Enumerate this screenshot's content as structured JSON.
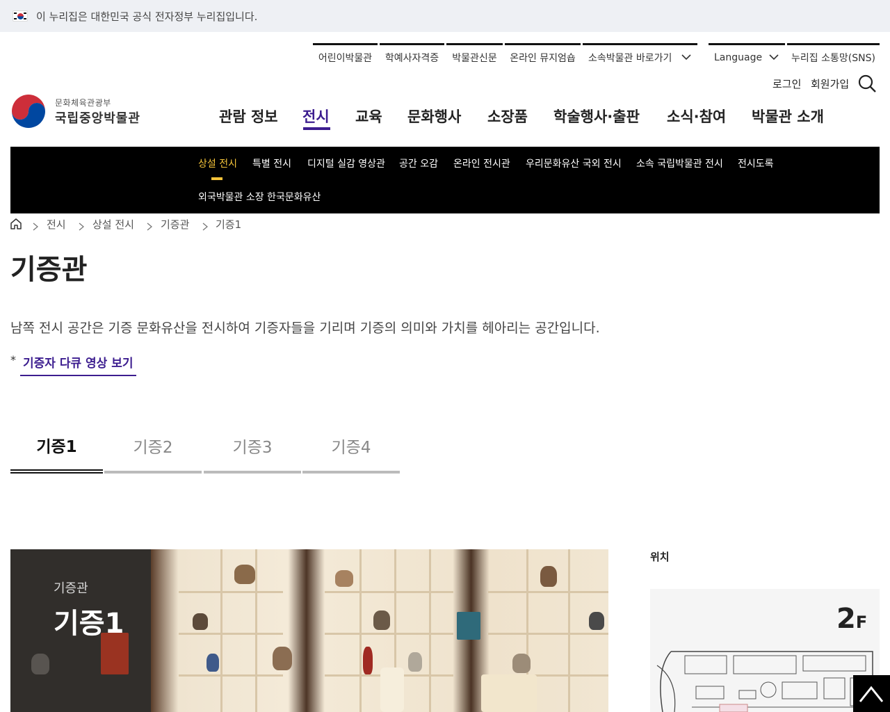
{
  "gov_banner": {
    "text": "이 누리집은 대한민국 공식 전자정부 누리집입니다."
  },
  "utility": {
    "links": [
      "어린이박물관",
      "학예사자격증",
      "박물관신문",
      "온라인 뮤지엄숍",
      "소속박물관 바로가기",
      "Language",
      "누리집 소통망(SNS)"
    ],
    "login": "로그인",
    "signup": "회원가입"
  },
  "logo": {
    "ministry": "문화체육관광부",
    "name": "국립중앙박물관"
  },
  "gnb": [
    "관람 정보",
    "전시",
    "교육",
    "문화행사",
    "소장품",
    "학술행사·출판",
    "소식·참여",
    "박물관 소개"
  ],
  "subnav": [
    "상설 전시",
    "특별 전시",
    "디지털 실감 영상관",
    "공간 오감",
    "온라인 전시관",
    "우리문화유산 국외 전시",
    "소속 국립박물관 전시",
    "전시도록",
    "외국박물관 소장 한국문화유산"
  ],
  "breadcrumb": [
    "전시",
    "상설 전시",
    "기증관",
    "기증1"
  ],
  "page": {
    "title": "기증관",
    "description": "남쪽 전시 공간은 기증 문화유산을 전시하여 기증자들을 기리며 기증의 의미와 가치를 헤아리는 공간입니다.",
    "asterisk": "*",
    "video_link": "기증자 다큐 영상 보기"
  },
  "tabs": [
    "기증1",
    "기증2",
    "기증3",
    "기증4"
  ],
  "gallery": {
    "subtitle": "기증관",
    "title": "기증1"
  },
  "location": {
    "label": "위치",
    "floor_num": "2",
    "floor_unit": "F"
  },
  "icons": {
    "home": "home-icon",
    "chevron": "chevron-down-icon",
    "search": "search-icon",
    "top": "arrow-up-icon"
  },
  "colors": {
    "accent": "#3c1d8f",
    "subnav_active": "#f5c43a",
    "subnav_bg": "#000000"
  }
}
